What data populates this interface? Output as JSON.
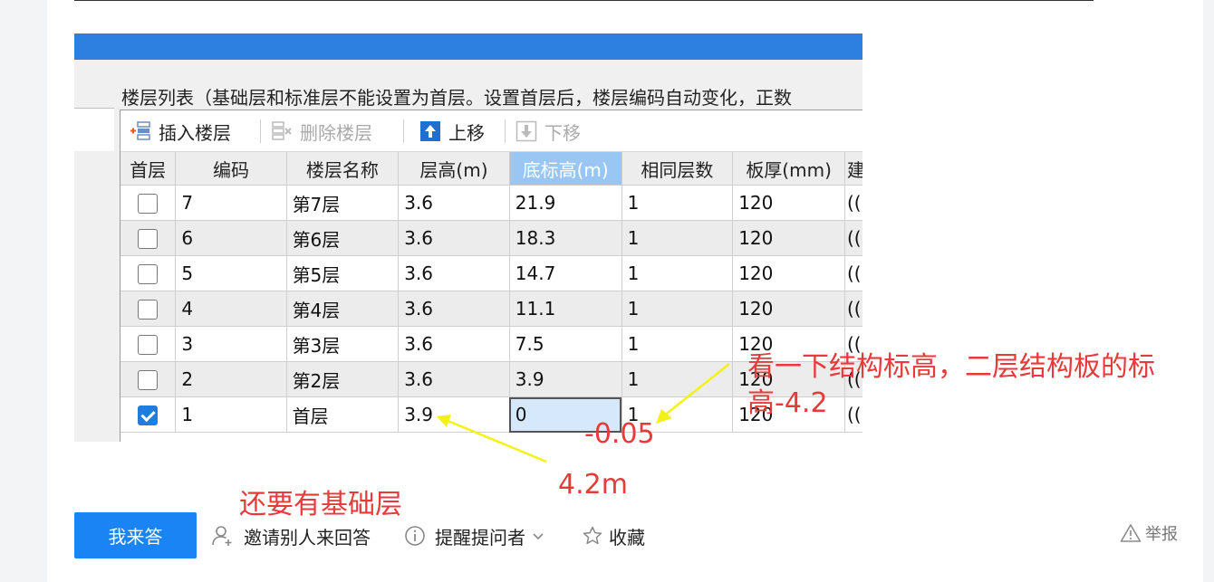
{
  "screenshot": {
    "panel_title": "楼层列表（基础层和标准层不能设置为首层。设置首层后，楼层编码自动变化，正数",
    "toolbar": {
      "insert": "插入楼层",
      "delete": "删除楼层",
      "move_up": "上移",
      "move_down": "下移"
    },
    "columns": [
      "首层",
      "编码",
      "楼层名称",
      "层高(m)",
      "底标高(m)",
      "相同层数",
      "板厚(mm)",
      "建"
    ],
    "rows": [
      {
        "first": false,
        "code": "7",
        "name": "第7层",
        "height": "3.6",
        "bottom": "21.9",
        "same": "1",
        "slab": "120",
        "extra": "(("
      },
      {
        "first": false,
        "code": "6",
        "name": "第6层",
        "height": "3.6",
        "bottom": "18.3",
        "same": "1",
        "slab": "120",
        "extra": "(("
      },
      {
        "first": false,
        "code": "5",
        "name": "第5层",
        "height": "3.6",
        "bottom": "14.7",
        "same": "1",
        "slab": "120",
        "extra": "(("
      },
      {
        "first": false,
        "code": "4",
        "name": "第4层",
        "height": "3.6",
        "bottom": "11.1",
        "same": "1",
        "slab": "120",
        "extra": "(("
      },
      {
        "first": false,
        "code": "3",
        "name": "第3层",
        "height": "3.6",
        "bottom": "7.5",
        "same": "1",
        "slab": "120",
        "extra": "(("
      },
      {
        "first": false,
        "code": "2",
        "name": "第2层",
        "height": "3.6",
        "bottom": "3.9",
        "same": "1",
        "slab": "120",
        "extra": "(("
      },
      {
        "first": true,
        "code": "1",
        "name": "首层",
        "height": "3.9",
        "bottom": "0",
        "same": "1",
        "slab": "120",
        "extra": "(("
      }
    ]
  },
  "annotations": {
    "structure_note_line1": "看一下结构标高，二层结构板的标",
    "structure_note_line2": "高-4.2",
    "bottom_value": "-0.05",
    "height_value": "4.2m",
    "foundation_note": "还要有基础层",
    "color": "#e83a3a",
    "arrow_color": "#f2f21a"
  },
  "actions": {
    "answer": "我来答",
    "invite": "邀请别人来回答",
    "remind": "提醒提问者",
    "favorite": "收藏",
    "report": "举报"
  },
  "colors": {
    "titlebar": "#2d7fe0",
    "answer_button": "#1a84f5",
    "active_header": "#9ac6f4",
    "checkbox_on": "#1f7de0"
  }
}
